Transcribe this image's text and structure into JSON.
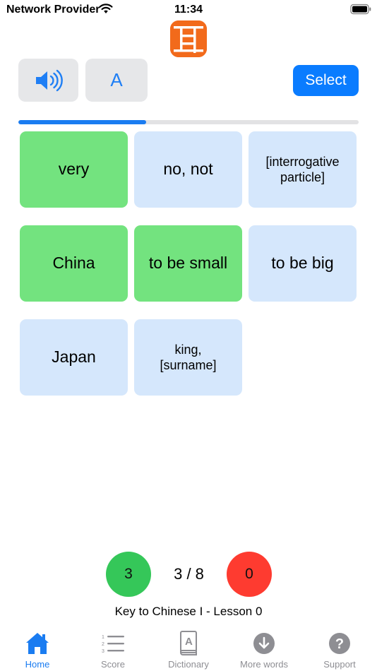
{
  "status_bar": {
    "carrier": "Network Provider",
    "time": "11:34"
  },
  "app": {
    "logo_icon": "chinese-character-logo-icon",
    "brand_color": "#f26a1b"
  },
  "toolbar": {
    "sound_icon": "speaker-icon",
    "letter_label": "A",
    "select_label": "Select"
  },
  "quiz_progress": {
    "fraction": 0.375
  },
  "answers": [
    {
      "label": "very",
      "state": "correct"
    },
    {
      "label": "no, not",
      "state": "default"
    },
    {
      "label": "[interrogative particle]",
      "state": "default"
    },
    {
      "label": "China",
      "state": "correct"
    },
    {
      "label": "to be small",
      "state": "correct"
    },
    {
      "label": "to be big",
      "state": "default"
    },
    {
      "label": "Japan",
      "state": "default"
    },
    {
      "label": "king, [surname]",
      "state": "default"
    }
  ],
  "score": {
    "correct": "3",
    "progress": "3 / 8",
    "wrong": "0",
    "lesson": "Key to Chinese I - Lesson 0"
  },
  "tabs": [
    {
      "label": "Home",
      "icon": "house-icon",
      "active": true
    },
    {
      "label": "Score",
      "icon": "numbered-list-icon",
      "active": false
    },
    {
      "label": "Dictionary",
      "icon": "book-icon",
      "active": false
    },
    {
      "label": "More words",
      "icon": "download-icon",
      "active": false
    },
    {
      "label": "Support",
      "icon": "question-icon",
      "active": false
    }
  ],
  "colors": {
    "accent": "#0a7cff",
    "correct_card": "#73e37f",
    "default_card": "#d5e7fc",
    "score_good": "#35c759",
    "score_bad": "#fe3b30"
  }
}
